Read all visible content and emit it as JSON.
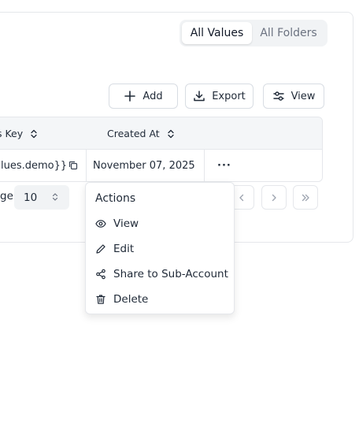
{
  "segmented": {
    "options": [
      {
        "label": "All Values",
        "active": true
      },
      {
        "label": "All Folders",
        "active": false
      }
    ]
  },
  "toolbar": {
    "add_label": "Add",
    "export_label": "Export",
    "view_label": "View"
  },
  "table": {
    "columns": [
      "s Key",
      "Created At"
    ],
    "rows": [
      {
        "key": "alues.demo}}",
        "created_at": "November 07, 2025",
        "actions": "···"
      }
    ]
  },
  "pagination": {
    "per_page_label": "ge",
    "per_page_value": "10"
  },
  "action_menu": {
    "title": "Actions",
    "items": [
      {
        "label": "View",
        "icon": "eye-icon"
      },
      {
        "label": "Edit",
        "icon": "pencil-icon"
      },
      {
        "label": "Share to Sub-Account",
        "icon": "share-icon"
      },
      {
        "label": "Delete",
        "icon": "trash-icon"
      }
    ]
  },
  "colors": {
    "border": "#e5e7eb",
    "header_bg": "#f4f6f8",
    "segment_bg": "#f1f3f5",
    "text": "#1f2937",
    "muted": "#6b7280"
  }
}
